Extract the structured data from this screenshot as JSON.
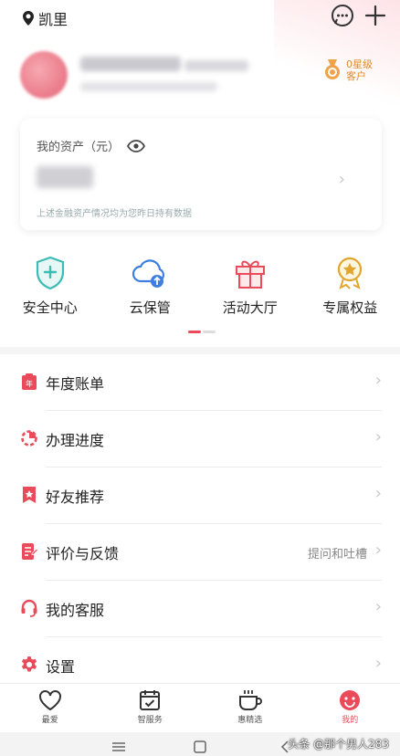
{
  "header": {
    "city": "凯里",
    "location_icon": "location-pin-icon",
    "message_icon": "chat-bubble-icon",
    "add_icon": "plus-icon"
  },
  "profile": {
    "level_line1": "0星级",
    "level_line2": "客户",
    "level_icon": "medal-icon"
  },
  "assets": {
    "title": "我的资产（元）",
    "eye_icon": "eye-icon",
    "note": "上述金融资产情况均为您昨日持有数据"
  },
  "quick": [
    {
      "label": "安全中心",
      "icon": "shield-plus-icon"
    },
    {
      "label": "云保管",
      "icon": "cloud-upload-icon"
    },
    {
      "label": "活动大厅",
      "icon": "gift-icon"
    },
    {
      "label": "专属权益",
      "icon": "star-badge-icon"
    }
  ],
  "menu": [
    {
      "label": "年度账单",
      "extra": "",
      "icon": "annual-bill-icon"
    },
    {
      "label": "办理进度",
      "extra": "",
      "icon": "progress-icon"
    },
    {
      "label": "好友推荐",
      "extra": "",
      "icon": "bookmark-star-icon"
    },
    {
      "label": "评价与反馈",
      "extra": "提问和吐槽",
      "icon": "feedback-icon"
    },
    {
      "label": "我的客服",
      "extra": "",
      "icon": "headset-icon"
    },
    {
      "label": "设置",
      "extra": "",
      "icon": "gear-icon"
    }
  ],
  "tabs": [
    {
      "label": "最爱",
      "icon": "heart-icon",
      "active": false
    },
    {
      "label": "智服务",
      "icon": "calendar-check-icon",
      "active": false
    },
    {
      "label": "惠精选",
      "icon": "cup-icon",
      "active": false
    },
    {
      "label": "我的",
      "icon": "smile-face-icon",
      "active": true
    }
  ],
  "watermark": "头条 @那个男人283",
  "colors": {
    "accent": "#e94b5a",
    "teal": "#3cbcb4",
    "blue": "#3d7ee0",
    "gold": "#e08a2c"
  }
}
